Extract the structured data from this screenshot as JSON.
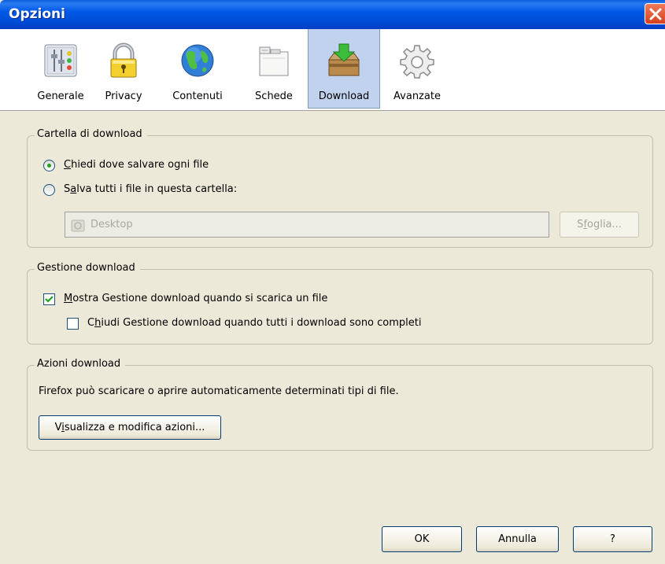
{
  "window": {
    "title": "Opzioni"
  },
  "tabs": [
    {
      "label": "Generale",
      "icon": "general-settings-icon"
    },
    {
      "label": "Privacy",
      "icon": "padlock-icon"
    },
    {
      "label": "Contenuti",
      "icon": "globe-icon"
    },
    {
      "label": "Schede",
      "icon": "tabs-window-icon"
    },
    {
      "label": "Download",
      "icon": "download-box-icon",
      "selected": true
    },
    {
      "label": "Avanzate",
      "icon": "gear-icon"
    }
  ],
  "folder_group": {
    "legend": "Cartella di download",
    "ask_option": {
      "accel": "C",
      "rest": "hiedi dove salvare ogni file",
      "checked": true
    },
    "save_option": {
      "pre": "S",
      "accel": "a",
      "rest": "lva tutti i file in questa cartella:",
      "checked": false
    },
    "folder_value": "Desktop",
    "browse_button": {
      "pre": "S",
      "accel": "f",
      "rest": "oglia...",
      "enabled": false
    }
  },
  "manager_group": {
    "legend": "Gestione download",
    "show_manager": {
      "accel": "M",
      "rest": "ostra Gestione download quando si scarica un file",
      "checked": true
    },
    "close_manager": {
      "pre": "C",
      "accel": "h",
      "rest": "iudi Gestione download quando tutti i download sono completi",
      "checked": false
    }
  },
  "actions_group": {
    "legend": "Azioni download",
    "description": "Firefox può scaricare o aprire automaticamente determinati tipi di file.",
    "view_button": {
      "pre": "V",
      "accel": "i",
      "rest": "sualizza e modifica azioni..."
    }
  },
  "footer": {
    "ok": "OK",
    "cancel": "Annulla",
    "help": "?"
  },
  "colors": {
    "titlebar": "#0058e6",
    "selected_tab": "#c1d2ee",
    "dialog_bg": "#ece9d8",
    "check_green": "#21a121"
  }
}
